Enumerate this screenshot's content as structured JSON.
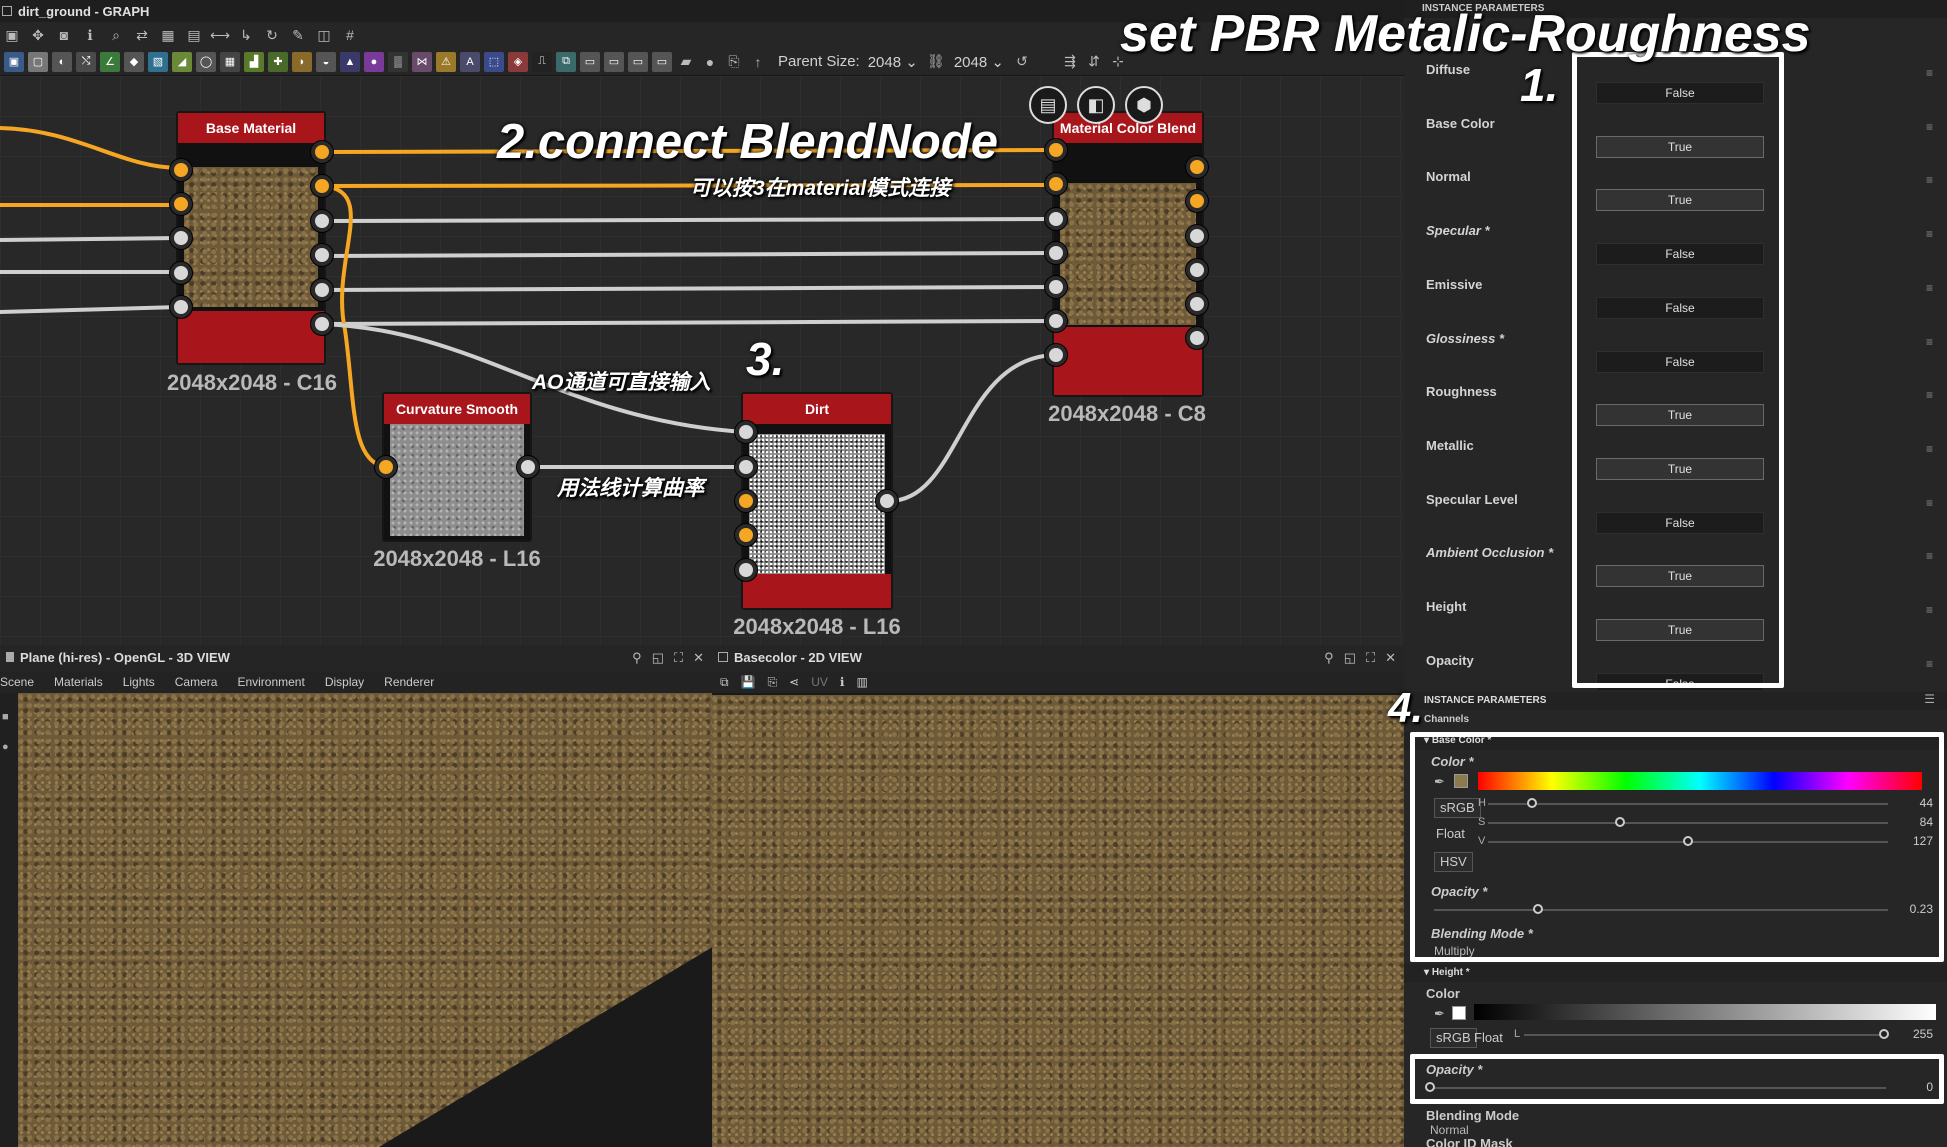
{
  "window": {
    "title": "dirt_ground - GRAPH"
  },
  "toolbar": {
    "parent_size_label": "Parent Size:",
    "parent_size_value": "2048",
    "size_value": "2048"
  },
  "nodes": {
    "base_material": {
      "title": "Base Material",
      "caption": "2048x2048 - C16"
    },
    "curvature_smooth": {
      "title": "Curvature Smooth",
      "caption": "2048x2048 - L16"
    },
    "dirt": {
      "title": "Dirt",
      "caption": "2048x2048 - L16"
    },
    "material_color_blend": {
      "title": "Material Color Blend",
      "caption": "2048x2048 - C8"
    }
  },
  "annotations": {
    "step1_title": "set PBR Metalic-Roughness",
    "step1_num": "1.",
    "step2": "2.connect BlendNode",
    "step2_note": "可以按3在material模式连接",
    "step3_num": "3.",
    "ao_note": "AO通道可直接输入",
    "curvature_note": "用法线计算曲率",
    "step4_num": "4."
  },
  "params_top": {
    "header": "INSTANCE PARAMETERS",
    "rows": [
      {
        "label": "Diffuse",
        "value": "False",
        "italic": false,
        "on": false
      },
      {
        "label": "Base Color",
        "value": "True",
        "italic": false,
        "on": true
      },
      {
        "label": "Normal",
        "value": "True",
        "italic": false,
        "on": true
      },
      {
        "label": "Specular *",
        "value": "False",
        "italic": true,
        "on": false
      },
      {
        "label": "Emissive",
        "value": "False",
        "italic": false,
        "on": false
      },
      {
        "label": "Glossiness *",
        "value": "False",
        "italic": true,
        "on": false
      },
      {
        "label": "Roughness",
        "value": "True",
        "italic": false,
        "on": true
      },
      {
        "label": "Metallic",
        "value": "True",
        "italic": false,
        "on": true
      },
      {
        "label": "Specular Level",
        "value": "False",
        "italic": false,
        "on": false
      },
      {
        "label": "Ambient Occlusion *",
        "value": "True",
        "italic": true,
        "on": true
      },
      {
        "label": "Height",
        "value": "True",
        "italic": false,
        "on": true
      },
      {
        "label": "Opacity",
        "value": "False",
        "italic": false,
        "on": false
      }
    ]
  },
  "params_bottom": {
    "header": "INSTANCE PARAMETERS",
    "channels_label": "Channels",
    "base_color": {
      "section": "Base Color *",
      "color_label": "Color *",
      "srgb": "sRGB",
      "float": "Float",
      "hsv": "HSV",
      "h_label": "H",
      "h_value": "44",
      "h_frac": 0.11,
      "s_label": "S",
      "s_value": "84",
      "s_frac": 0.33,
      "v_label": "V",
      "v_value": "127",
      "v_frac": 0.5,
      "opacity_label": "Opacity *",
      "opacity_value": "0.23",
      "opacity_frac": 0.23,
      "blend_label": "Blending Mode *",
      "blend_value": "Multiply",
      "swatch_color": "#8c7b4e"
    },
    "height": {
      "section": "Height *",
      "color_label": "Color",
      "srgb": "sRGB",
      "float": "Float",
      "l_label": "L",
      "l_value": "255",
      "l_frac": 1.0,
      "opacity_label": "Opacity *",
      "opacity_value": "0",
      "opacity_frac": 0,
      "blend_label": "Blending Mode",
      "blend_value": "Normal",
      "mask_label": "Color ID Mask"
    }
  },
  "view3d": {
    "title": "Plane (hi-res) - OpenGL - 3D VIEW",
    "menu": [
      "Scene",
      "Materials",
      "Lights",
      "Camera",
      "Environment",
      "Display",
      "Renderer"
    ]
  },
  "view2d": {
    "title": "Basecolor - 2D VIEW",
    "uv_label": "UV"
  }
}
